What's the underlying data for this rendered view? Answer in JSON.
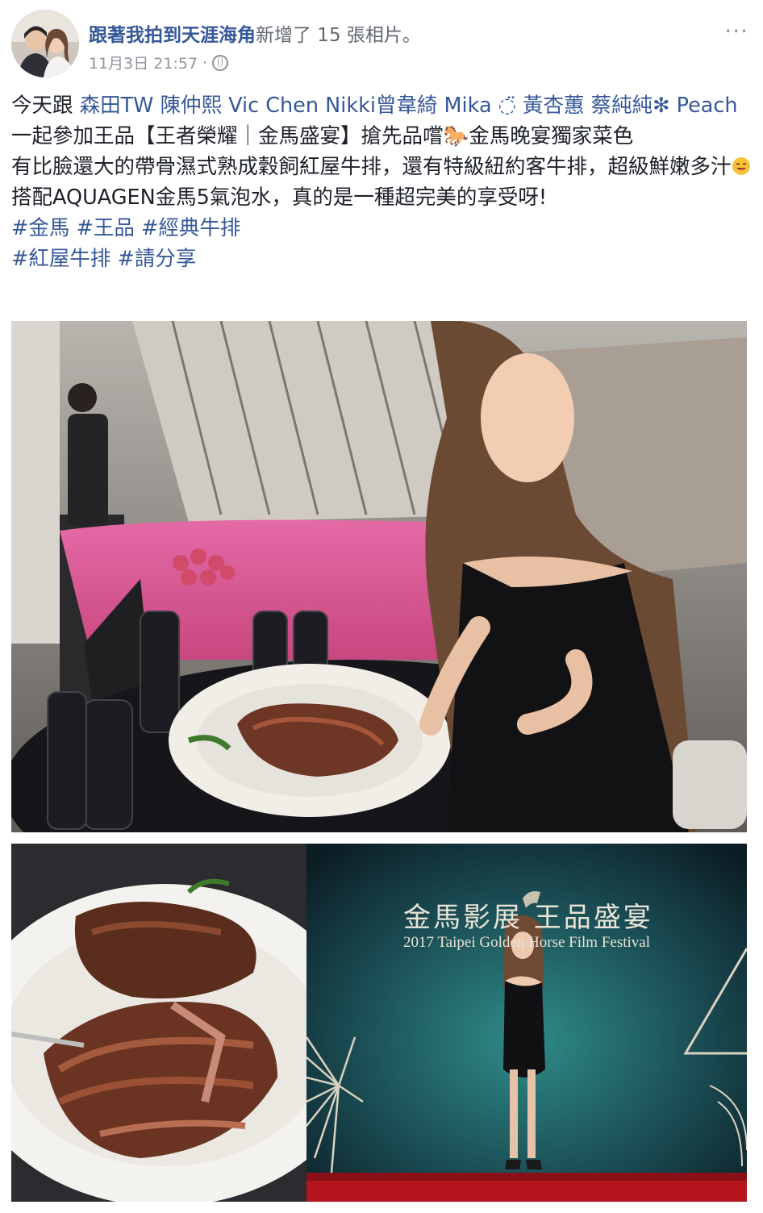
{
  "post": {
    "author": "跟著我拍到天涯海角",
    "action": "新增了 15 張相片。",
    "timestamp": "11月3日 21:57",
    "separator": "·",
    "menu_glyph": "···"
  },
  "content": {
    "line1_prefix": "今天跟 ",
    "tags": [
      "森田TW",
      "陳仲熙 Vic Chen",
      "Nikki曾韋綺",
      "Mika ◌̈ 黃杏蕙",
      "蔡純純✻ Peach"
    ],
    "line1_suffix": " 一起參加王品【王者榮耀｜金馬盛宴】搶先品嚐🐎金馬晚宴獨家菜色",
    "line2": "有比臉還大的帶骨濕式熟成穀飼紅屋牛排，還有特級紐約客牛排，超級鮮嫩多汁",
    "line2_after_emoji": "搭配AQUAGEN金馬5氣泡水，真的是一種超完美的享受呀!",
    "hashtags_row1": [
      "#金馬",
      "#王品",
      "#經典牛排"
    ],
    "hashtags_row2": [
      "#紅屋牛排",
      "#請分享"
    ]
  },
  "photos": {
    "banner_title": "金馬影展 王品盛宴",
    "banner_subtitle": "2017 Taipei Golden Horse Film Festival"
  },
  "colors": {
    "link": "#365899",
    "text": "#1d2129",
    "meta": "#90949c"
  }
}
